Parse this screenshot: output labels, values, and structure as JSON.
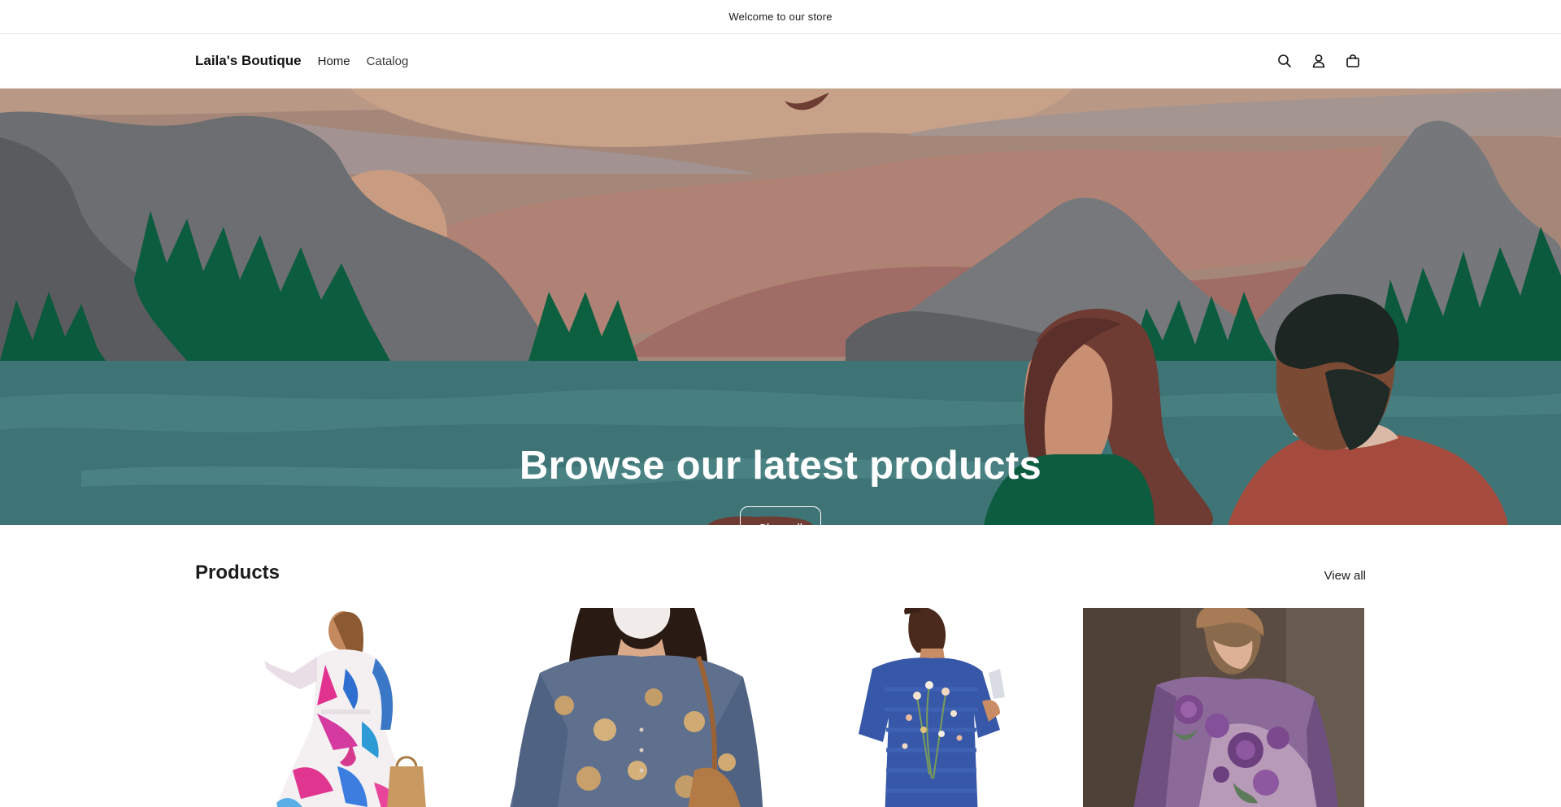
{
  "announcement": {
    "text": "Welcome to our store"
  },
  "header": {
    "logo": "Laila's Boutique",
    "nav": [
      {
        "label": "Home"
      },
      {
        "label": "Catalog"
      }
    ],
    "icons": [
      "search-icon",
      "account-icon",
      "cart-icon"
    ]
  },
  "hero": {
    "title": "Browse our latest products",
    "button_label": "Shop all"
  },
  "products": {
    "title": "Products",
    "view_all_label": "View all",
    "items": [
      {
        "image": "woman-in-colorful-floral-maxi-dress"
      },
      {
        "image": "woman-in-blue-floral-blouse-with-mask"
      },
      {
        "image": "woman-in-blue-embroidered-tshirt-back-view"
      },
      {
        "image": "woman-in-purple-rose-appliqué-top"
      }
    ]
  },
  "colors": {
    "water": "#3f7476",
    "forest": "#0c5c3f",
    "mountain": "#6b6d70",
    "sky": "#a5877a"
  }
}
